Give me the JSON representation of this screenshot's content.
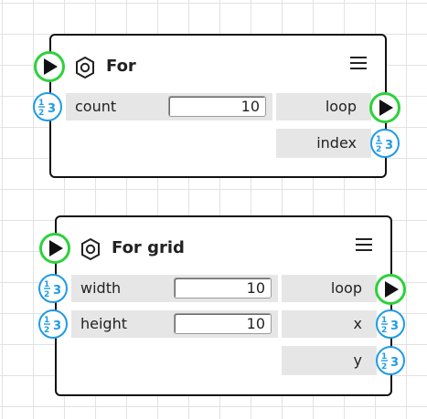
{
  "nodes": [
    {
      "title": "For",
      "inputs": [
        {
          "label": "count",
          "value": "10"
        }
      ],
      "outputs": [
        {
          "label": "loop"
        },
        {
          "label": "index"
        }
      ]
    },
    {
      "title": "For grid",
      "inputs": [
        {
          "label": "width",
          "value": "10"
        },
        {
          "label": "height",
          "value": "10"
        }
      ],
      "outputs": [
        {
          "label": "loop"
        },
        {
          "label": "x"
        },
        {
          "label": "y"
        }
      ]
    }
  ],
  "colors": {
    "exec_port": "#2ed13c",
    "number_port": "#1e9be6",
    "field_bg": "#e6e6e6",
    "grid_line": "#e2e2e2"
  },
  "icons": {
    "node": "hexagon-ring-icon",
    "menu": "hamburger-menu-icon",
    "exec_port": "play-triangle-icon",
    "number_port": "number-type-icon"
  }
}
